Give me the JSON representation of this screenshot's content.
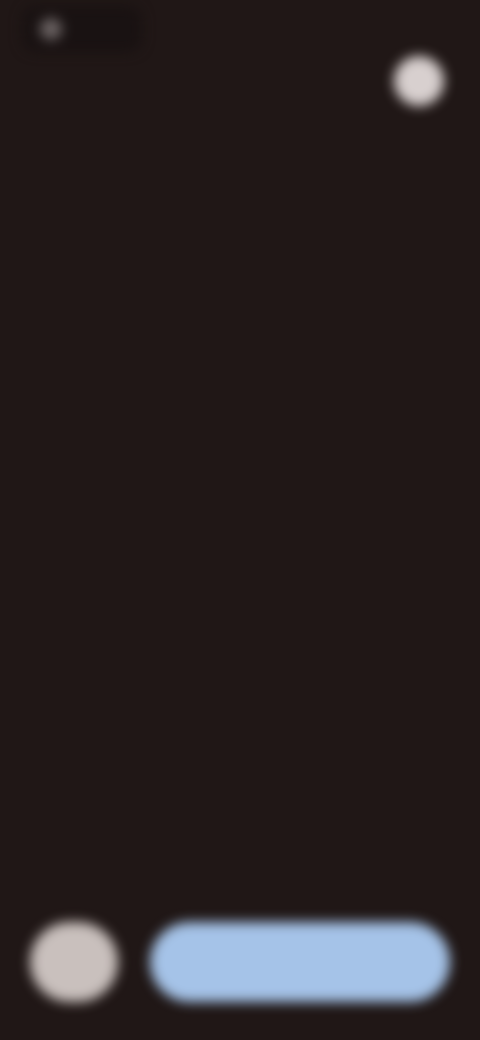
{
  "status_bar": {
    "label": ""
  },
  "header": {
    "top_right_button_icon": "person-icon"
  },
  "message": {
    "title": "",
    "body": ""
  },
  "footer": {
    "left_button_icon": "circle-icon",
    "primary_button_label": ""
  },
  "colors": {
    "background": "#201716",
    "primary_button": "#a5c3e8",
    "secondary_button": "#c9c0bd"
  }
}
